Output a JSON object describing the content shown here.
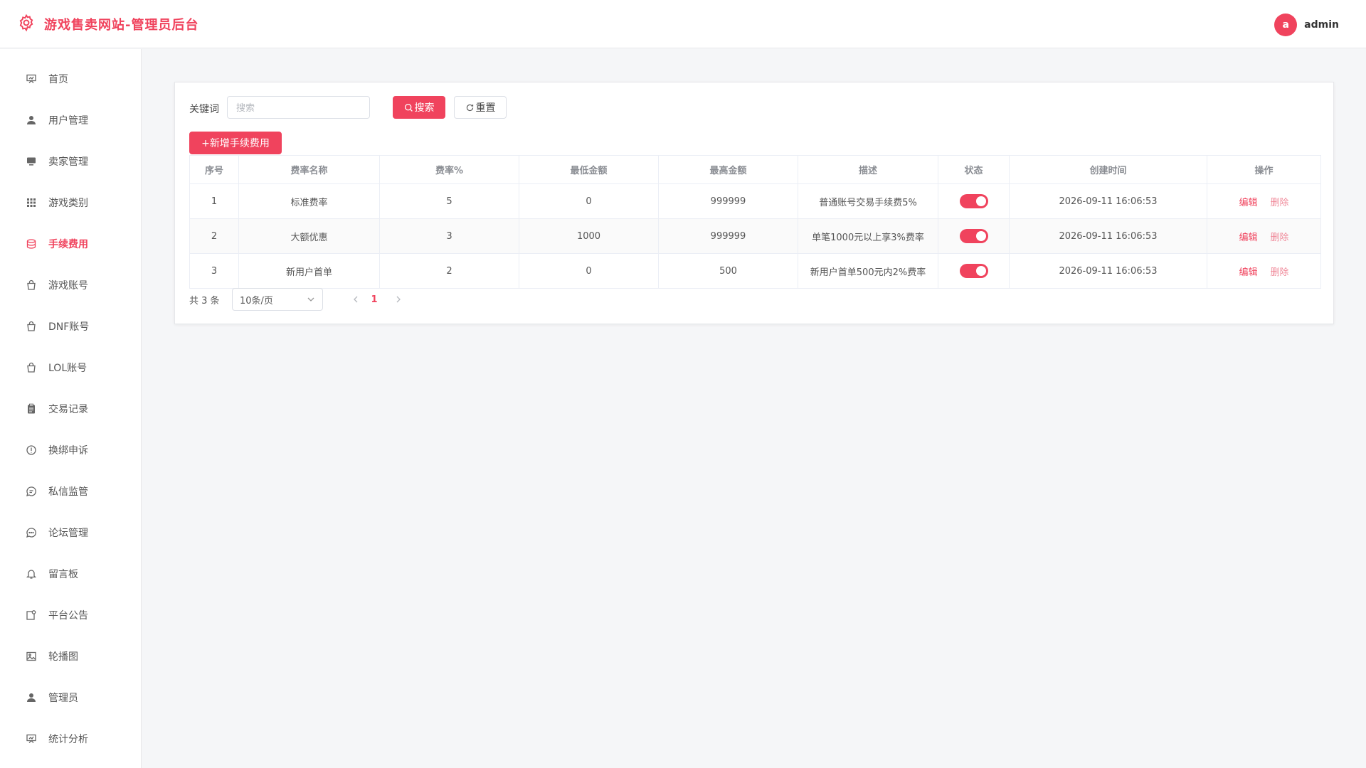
{
  "app": {
    "title": "游戏售卖网站-管理员后台",
    "accent_color": "#f0435d"
  },
  "user": {
    "avatar_letter": "a",
    "name": "admin"
  },
  "sidebar": {
    "items": [
      {
        "label": "首页",
        "icon": "presentation-icon"
      },
      {
        "label": "用户管理",
        "icon": "user-icon"
      },
      {
        "label": "卖家管理",
        "icon": "monitor-icon"
      },
      {
        "label": "游戏类别",
        "icon": "grid-icon"
      },
      {
        "label": "手续费用",
        "icon": "coins-icon",
        "active": true
      },
      {
        "label": "游戏账号",
        "icon": "bag-icon"
      },
      {
        "label": "DNF账号",
        "icon": "bag-icon"
      },
      {
        "label": "LOL账号",
        "icon": "bag-icon"
      },
      {
        "label": "交易记录",
        "icon": "clipboard-icon"
      },
      {
        "label": "换绑申诉",
        "icon": "warning-circle-icon"
      },
      {
        "label": "私信监管",
        "icon": "chat-icon"
      },
      {
        "label": "论坛管理",
        "icon": "chat-dots-icon"
      },
      {
        "label": "留言板",
        "icon": "bell-icon"
      },
      {
        "label": "平台公告",
        "icon": "notice-icon"
      },
      {
        "label": "轮播图",
        "icon": "image-icon"
      },
      {
        "label": "管理员",
        "icon": "admin-icon"
      },
      {
        "label": "统计分析",
        "icon": "chart-icon"
      }
    ]
  },
  "filter": {
    "keyword_label": "关键词",
    "search_placeholder": "搜索",
    "search_value": "",
    "search_btn": "搜索",
    "reset_btn": "重置",
    "add_btn": "+新增手续费用"
  },
  "table": {
    "columns": [
      "序号",
      "费率名称",
      "费率%",
      "最低金额",
      "最高金额",
      "描述",
      "状态",
      "创建时间",
      "操作"
    ],
    "rows": [
      {
        "index": "1",
        "name": "标准费率",
        "rate": "5",
        "min": "0",
        "max": "999999",
        "desc": "普通账号交易手续费5%",
        "status_on": true,
        "created": "2026-09-11 16:06:53"
      },
      {
        "index": "2",
        "name": "大额优惠",
        "rate": "3",
        "min": "1000",
        "max": "999999",
        "desc": "单笔1000元以上享3%费率",
        "status_on": true,
        "created": "2026-09-11 16:06:53"
      },
      {
        "index": "3",
        "name": "新用户首单",
        "rate": "2",
        "min": "0",
        "max": "500",
        "desc": "新用户首单500元内2%费率",
        "status_on": true,
        "created": "2026-09-11 16:06:53"
      }
    ],
    "edit_label": "编辑",
    "delete_label": "删除"
  },
  "pagination": {
    "total_text": "共 3 条",
    "page_size": "10条/页",
    "current_page": "1"
  }
}
